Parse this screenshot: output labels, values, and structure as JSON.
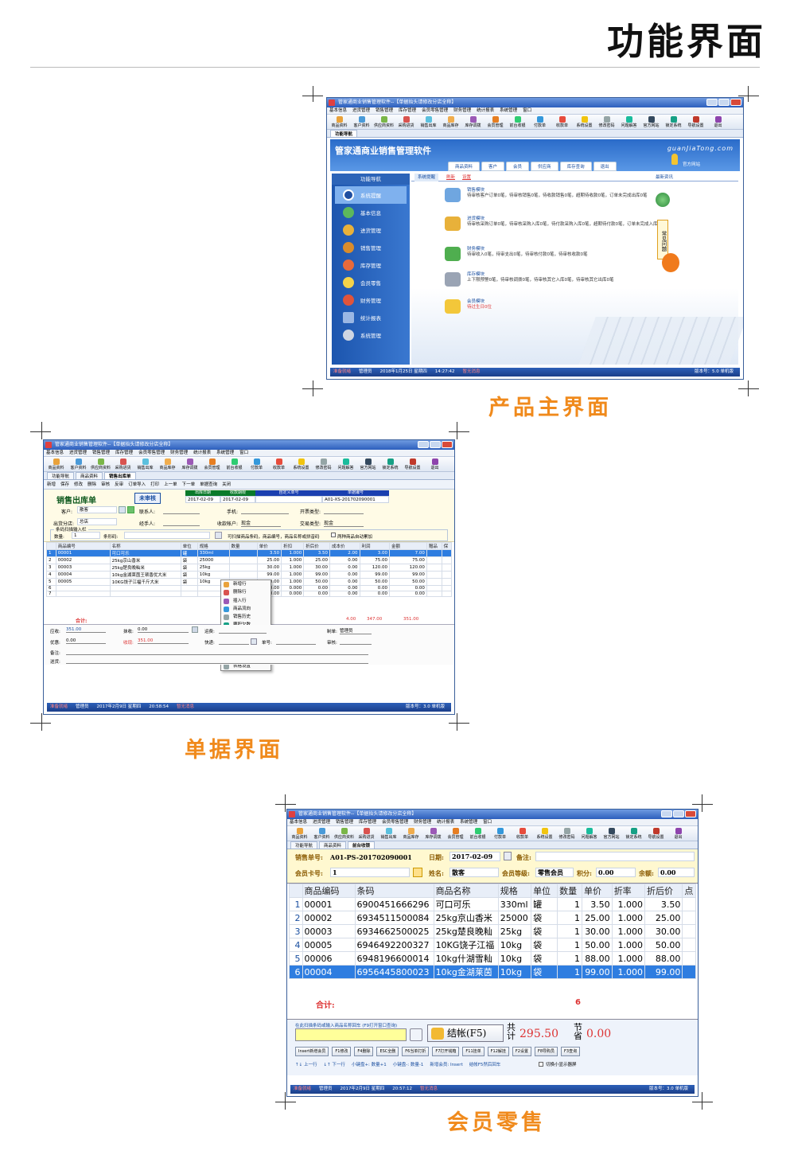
{
  "header": {
    "title": "功能界面"
  },
  "captions": {
    "main": "产品主界面",
    "document": "单据界面",
    "member": "会员零售"
  },
  "common": {
    "menus": [
      "基本信息",
      "进货管理",
      "销售管理",
      "库存管理",
      "会员零售管理",
      "财务管理",
      "统计报表",
      "系统管理",
      "窗口"
    ],
    "tools": [
      "商品资料",
      "客户资料",
      "供应商资料",
      "采购进货",
      "销售出库",
      "商品库存",
      "库存调拨",
      "会员管理",
      "前台收银",
      "付款单",
      "收款单",
      "系统设置",
      "修改密码",
      "问题解答",
      "官方网站",
      "锁定系统",
      "导航设置",
      "退出"
    ],
    "status": {
      "ready": "准备就绪",
      "user": "管理员",
      "lucky": "暂无消息"
    }
  },
  "win1": {
    "title": "管家通商业销售管理软件--【单据抬头请修改分店全称】",
    "tab": "功能导航",
    "banner_title": "管家通商业销售管理软件",
    "banner_url": "guanJiaTong.com",
    "banner_tabs": [
      "商品资料",
      "客户",
      "会员",
      "供应商",
      "库存查询",
      "退出"
    ],
    "official": "官方网站",
    "nav_header": "功能导航",
    "nav": [
      "系统提醒",
      "基本信息",
      "进货管理",
      "销售管理",
      "库存管理",
      "会员零售",
      "财务管理",
      "统计报表",
      "系统管理"
    ],
    "subtabs": {
      "a": "系统提醒",
      "refresh": "刷新",
      "settings": "设置",
      "news": "最新资讯"
    },
    "modules": [
      {
        "title": "销售模块",
        "text": "待审核客户订单0笔，待审核销售0笔，待收款销售0笔，超期待收款0笔，订单未完成出库0笔"
      },
      {
        "title": "进货模块",
        "text": "待审核采购订单0笔，待审核采购入库0笔，待付款采购入库0笔，超期待付款0笔，订单未完成入库0笔"
      },
      {
        "title": "财务模块",
        "text": "待审收入0笔，待审支出0笔，待审核付款0笔，待审核收款0笔"
      },
      {
        "title": "库存模块",
        "text": "上下限预警0笔，待审核调拨0笔，待审核其它入库0笔，待审核其它出库0笔"
      },
      {
        "title": "会员模块",
        "text": "待过生日0位"
      }
    ],
    "faq": "常见问题",
    "status": {
      "date": "2018年1月25日 星期四",
      "time": "14:27:42",
      "version": "版本号：5.0 单机版"
    }
  },
  "win2": {
    "title": "管家通商业销售管理软件--【单据抬头请修改分店全称】",
    "tabs": [
      "功能导航",
      "商品资料",
      "销售出库单"
    ],
    "actions": [
      "新增",
      "保存",
      "修改",
      "删除",
      "审核",
      "反审",
      "订单导入",
      "打印",
      "上一单",
      "下一单",
      "单据查询",
      "关闭"
    ],
    "doc_title": "销售出库单",
    "stamp": "未审核",
    "meta_heads": [
      "出库日期",
      "收款期限",
      "自定义单号",
      "单据编号"
    ],
    "meta_vals": [
      "2017-02-09",
      "2017-02-09",
      "",
      "A01-XS-201702090001"
    ],
    "form": {
      "customer_l": "客户:",
      "customer_v": "散客",
      "contact_l": "联系人:",
      "mobile_l": "手机:",
      "invoice_l": "开票类型:",
      "branch_l": "出货分店:",
      "branch_v": "总店",
      "handler_l": "经手人:",
      "account_l": "收款帐户:",
      "account_v": "现金",
      "trade_l": "交易类型:",
      "trade_v": "现金"
    },
    "scan": {
      "legend": "条码扫描输入栏",
      "qty_l": "数量:",
      "qty_v": "1",
      "type_l": "条形码:",
      "hint": "可扫描商品条码，商品编号，商品名称或拼音码",
      "auto": "两种商品自动累加"
    },
    "columns": [
      "",
      "商品编号",
      "名称",
      "单位",
      "规格",
      "数量",
      "单价",
      "折扣",
      "折后价",
      "成本价",
      "利润",
      "金额",
      "赠品",
      "保"
    ],
    "rows": [
      [
        "1",
        "00001",
        "可口可乐",
        "罐",
        "330ml",
        "",
        "3.50",
        "1.000",
        "3.50",
        "2.00",
        "3.00",
        "7.00",
        ""
      ],
      [
        "2",
        "00002",
        "25kg京山香米",
        "袋",
        "25000",
        "",
        "25.00",
        "1.000",
        "25.00",
        "0.00",
        "75.00",
        "75.00",
        ""
      ],
      [
        "3",
        "00003",
        "25kg楚良晚籼米",
        "袋",
        "25kg",
        "",
        "30.00",
        "1.000",
        "30.00",
        "0.00",
        "120.00",
        "120.00",
        ""
      ],
      [
        "4",
        "00004",
        "10kg金湖莱茵王顿香优大米",
        "袋",
        "10kg",
        "",
        "99.00",
        "1.000",
        "99.00",
        "0.00",
        "99.00",
        "99.00",
        ""
      ],
      [
        "5",
        "00005",
        "10KG饶子江福千斤大米",
        "袋",
        "10kg",
        "",
        "50.00",
        "1.000",
        "50.00",
        "0.00",
        "50.00",
        "50.00",
        ""
      ],
      [
        "6",
        "",
        "",
        "",
        "",
        "",
        "0.00",
        "0.000",
        "0.00",
        "0.00",
        "0.00",
        "0.00",
        ""
      ],
      [
        "7",
        "",
        "",
        "",
        "",
        "",
        "0.00",
        "0.000",
        "0.00",
        "0.00",
        "0.00",
        "0.00",
        ""
      ]
    ],
    "total_label": "合计:",
    "totals": {
      "cost": "4.00",
      "profit": "347.00",
      "amount": "351.00"
    },
    "context_menu": [
      "新增行",
      "删除行",
      "插入行",
      "商品流向",
      "销售历史",
      "要积欠数",
      "复制单据",
      "从订单导入",
      "调用客户价格",
      "导出EXCEL",
      "表格设置"
    ],
    "footer": {
      "receivable_l": "应收:",
      "receivable_v": "351.00",
      "discount_l": "抹收:",
      "discount_v": "0.00",
      "freight_l": "运费:",
      "maker_l": "制单:",
      "maker_v": "管理员",
      "coupon_l": "优惠:",
      "coupon_v": "0.00",
      "received_l": "收现:",
      "received_v": "351.00",
      "express_l": "快递:",
      "waybill_l": "单号:",
      "auditor_l": "审核:",
      "note_l": "备注:",
      "address_l": "送货:"
    },
    "status": {
      "date": "2017年2月9日 星期四",
      "time": "20:58:54",
      "version": "版本号：3.0 单机版"
    }
  },
  "win3": {
    "title": "管家通商业销售管理软件--【单据抬头请修改分店全称】",
    "tabs": [
      "功能导航",
      "商品资料",
      "前台收银"
    ],
    "doc_l": "销售单号:",
    "doc_v": "A01-PS-201702090001",
    "date_l": "日期:",
    "date_v": "2017-02-09",
    "note_l": "备注:",
    "card_l": "会员卡号:",
    "card_v": "1",
    "name_l": "姓名:",
    "name_v": "散客",
    "level_l": "会员等级:",
    "level_v": "零售会员",
    "points_l": "积分:",
    "points_v": "0.00",
    "balance_l": "余额:",
    "balance_v": "0.00",
    "columns": [
      "",
      "商品编码",
      "条码",
      "商品名称",
      "规格",
      "单位",
      "数量",
      "单价",
      "折率",
      "折后价",
      "点"
    ],
    "rows": [
      [
        "1",
        "00001",
        "6900451666296",
        "可口可乐",
        "330ml",
        "罐",
        "1",
        "3.50",
        "1.000",
        "3.50"
      ],
      [
        "2",
        "00002",
        "6934511500084",
        "25kg京山香米",
        "25000",
        "袋",
        "1",
        "25.00",
        "1.000",
        "25.00"
      ],
      [
        "3",
        "00003",
        "6934662500025",
        "25kg楚良晚籼",
        "25kg",
        "袋",
        "1",
        "30.00",
        "1.000",
        "30.00"
      ],
      [
        "4",
        "00005",
        "6946492200327",
        "10KG饶子江福",
        "10kg",
        "袋",
        "1",
        "50.00",
        "1.000",
        "50.00"
      ],
      [
        "5",
        "00006",
        "6948196600014",
        "10kg什湖雪籼",
        "10kg",
        "袋",
        "1",
        "88.00",
        "1.000",
        "88.00"
      ],
      [
        "6",
        "00004",
        "6956445800023",
        "10kg金湖莱茵",
        "10kg",
        "袋",
        "1",
        "99.00",
        "1.000",
        "99.00"
      ]
    ],
    "total_label": "合计:",
    "total_count": "6",
    "scan_hint": "在此扫描条码或输入商品名称回车 (F9打开窗口查询)",
    "checkout": "结帐(F5)",
    "total_l": "共计",
    "total_v": "295.50",
    "save_l": "节省",
    "save_v": "0.00",
    "fkeys": [
      "Insert新增会员",
      "F1修改",
      "F4删除",
      "ESC全删",
      "F6当单打折",
      "F7打开钱箱",
      "F11挂单",
      "F12解挂",
      "F2设置",
      "F8导购员",
      "F3查询"
    ],
    "hints": [
      "↑↓ 上一行",
      "↓↑ 下一行",
      "小键盘+: 数量+1",
      "小键盘-: 数量-1",
      "新增会员: Insert",
      "结帐F5然后回车"
    ],
    "toggle": "切换小显示器屏",
    "status": {
      "date": "2017年2月9日 星期四",
      "time": "20:57:12",
      "version": "版本号：3.0 单机版"
    }
  }
}
